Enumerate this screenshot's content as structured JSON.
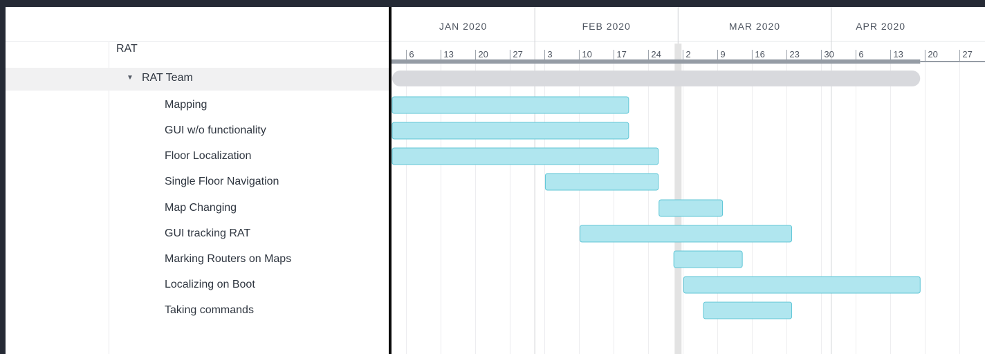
{
  "project": {
    "name": "RAT"
  },
  "group": {
    "name": "RAT Team",
    "expand_icon": "triangle-down-icon"
  },
  "colors": {
    "task_bar": "#b0e6ef",
    "task_bar_border": "#5fc6d6",
    "group_bar": "#d8d9dd",
    "today_marker": "#e3e3e3",
    "background": "#252a35"
  },
  "chart_data": {
    "type": "gantt",
    "months": [
      "JAN 2020",
      "FEB 2020",
      "MAR 2020",
      "APR 2020"
    ],
    "week_ticks": [
      "2020-01-06",
      "2020-01-13",
      "2020-01-20",
      "2020-01-27",
      "2020-02-03",
      "2020-02-10",
      "2020-02-17",
      "2020-02-24",
      "2020-03-02",
      "2020-03-09",
      "2020-03-16",
      "2020-03-23",
      "2020-03-30",
      "2020-04-06",
      "2020-04-13",
      "2020-04-20",
      "2020-04-27"
    ],
    "week_tick_labels": [
      "6",
      "13",
      "20",
      "27",
      "3",
      "10",
      "17",
      "24",
      "2",
      "9",
      "16",
      "23",
      "30",
      "6",
      "13",
      "20",
      "27"
    ],
    "x_range": [
      "2020-01-03",
      "2020-05-01"
    ],
    "today": "2020-03-01",
    "group_bar": {
      "name": "RAT Team",
      "start": "2020-01-03",
      "end": "2020-04-19"
    },
    "tasks": [
      {
        "name": "Mapping",
        "start": "2020-01-03",
        "end": "2020-02-20"
      },
      {
        "name": "GUI w/o functionality",
        "start": "2020-01-03",
        "end": "2020-02-20"
      },
      {
        "name": "Floor Localization",
        "start": "2020-01-03",
        "end": "2020-02-26"
      },
      {
        "name": "Single Floor Navigation",
        "start": "2020-02-03",
        "end": "2020-02-26"
      },
      {
        "name": "Map Changing",
        "start": "2020-02-26",
        "end": "2020-03-10"
      },
      {
        "name": "GUI tracking RAT",
        "start": "2020-02-10",
        "end": "2020-03-24"
      },
      {
        "name": "Marking Routers on Maps",
        "start": "2020-02-29",
        "end": "2020-03-14"
      },
      {
        "name": "Localizing on Boot",
        "start": "2020-03-02",
        "end": "2020-04-19"
      },
      {
        "name": "Taking commands",
        "start": "2020-03-06",
        "end": "2020-03-24"
      }
    ]
  }
}
